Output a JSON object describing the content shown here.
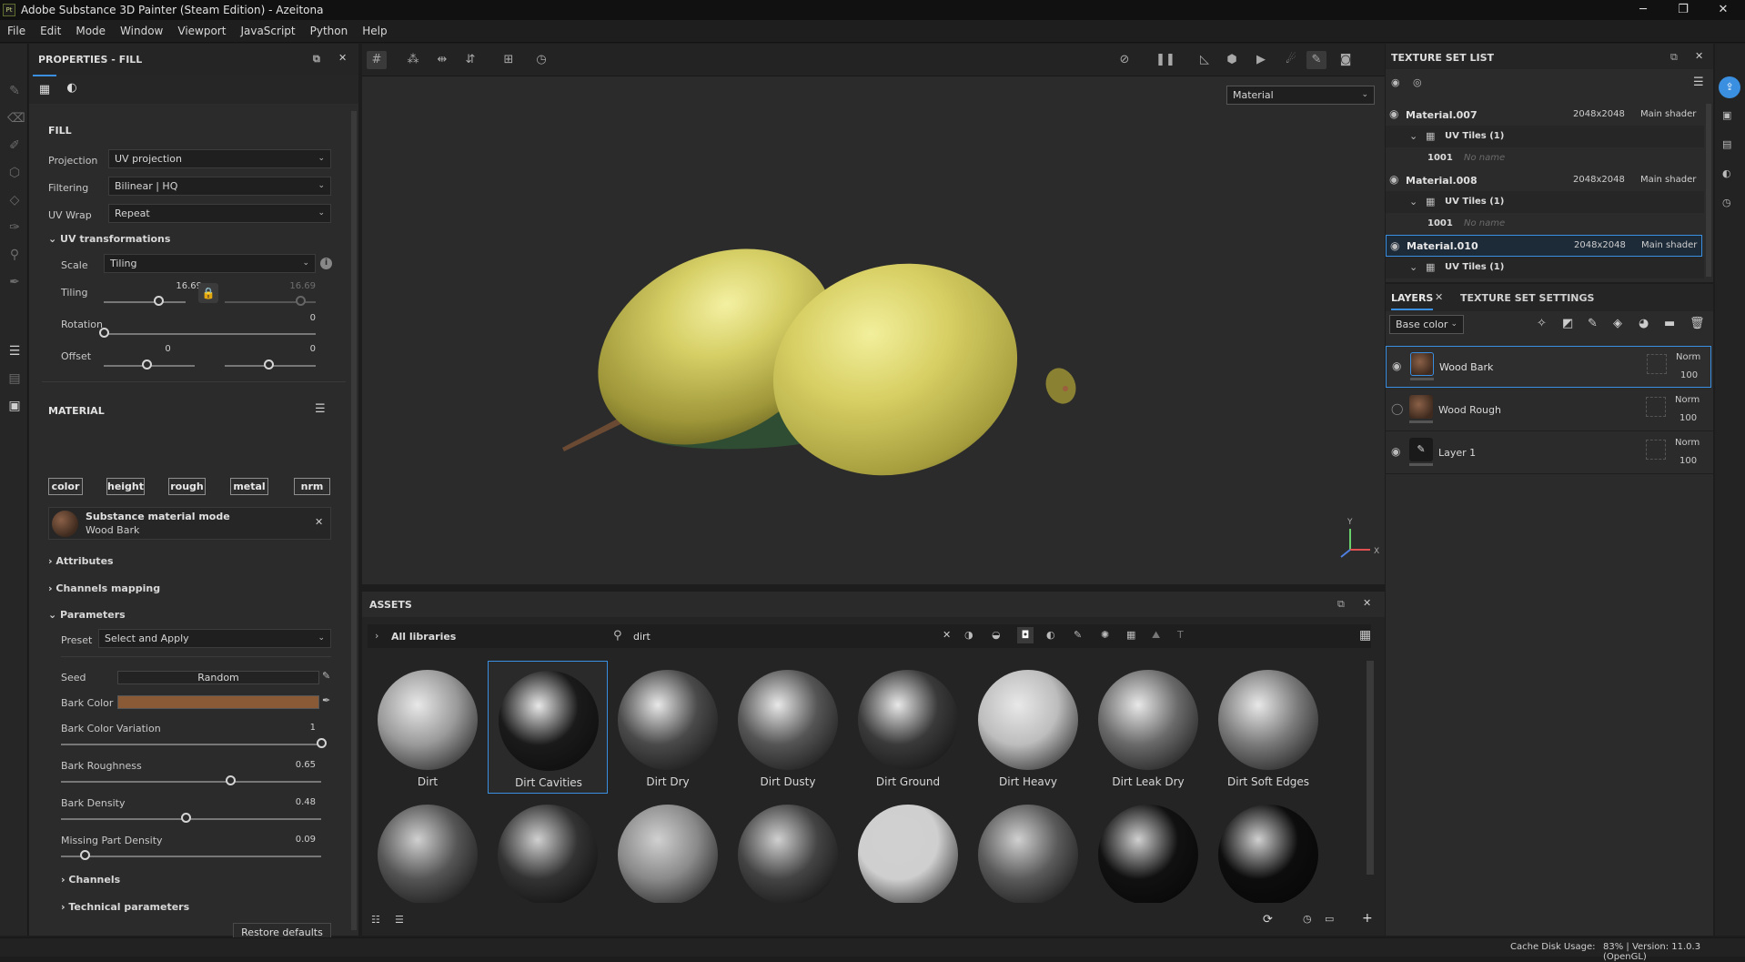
{
  "window": {
    "title": "Adobe Substance 3D Painter (Steam Edition) - Azeitona",
    "app_icon": "Pt"
  },
  "menu": [
    "File",
    "Edit",
    "Mode",
    "Window",
    "Viewport",
    "JavaScript",
    "Python",
    "Help"
  ],
  "properties": {
    "title": "PROPERTIES - FILL",
    "fill_header": "FILL",
    "projection": {
      "label": "Projection",
      "value": "UV projection"
    },
    "filtering": {
      "label": "Filtering",
      "value": "Bilinear | HQ"
    },
    "uv_wrap": {
      "label": "UV Wrap",
      "value": "Repeat"
    },
    "uv_transformations": {
      "header": "UV transformations",
      "scale": {
        "label": "Scale",
        "value": "Tiling"
      },
      "tiling": {
        "label": "Tiling",
        "value_u": "16.69",
        "value_v": "16.69",
        "u_fraction": 0.67
      },
      "rotation": {
        "label": "Rotation",
        "value": "0",
        "fraction": 0.0
      },
      "offset": {
        "label": "Offset",
        "value_u": "0",
        "value_v": "0",
        "u_fraction": 0.5,
        "v_fraction": 0.5
      }
    },
    "material": {
      "header": "MATERIAL",
      "channels": [
        "color",
        "height",
        "rough",
        "metal",
        "nrm"
      ],
      "mode_title": "Substance material mode",
      "mode_name": "Wood Bark"
    },
    "attributes": "Attributes",
    "channels_mapping": "Channels mapping",
    "parameters": {
      "header": "Parameters",
      "preset": {
        "label": "Preset",
        "value": "Select and Apply"
      },
      "seed": {
        "label": "Seed",
        "value": "Random"
      },
      "bark_color": {
        "label": "Bark Color",
        "color": "#8a5a36"
      },
      "bark_color_variation": {
        "label": "Bark Color Variation",
        "value": "1",
        "fraction": 1.0
      },
      "bark_roughness": {
        "label": "Bark Roughness",
        "value": "0.65",
        "fraction": 0.65
      },
      "bark_density": {
        "label": "Bark Density",
        "value": "0.48",
        "fraction": 0.48
      },
      "missing_part_density": {
        "label": "Missing Part Density",
        "value": "0.09",
        "fraction": 0.09
      }
    },
    "channels": "Channels",
    "technical_parameters": "Technical parameters",
    "restore_defaults": "Restore defaults"
  },
  "viewport": {
    "mode": "Material",
    "gizmo_y": "Y",
    "gizmo_x": "X"
  },
  "assets": {
    "title": "ASSETS",
    "library": "All libraries",
    "search": "dirt",
    "items": [
      {
        "name": "Dirt",
        "shade": "#9a9a9a",
        "selected": false
      },
      {
        "name": "Dirt Cavities",
        "shade": "#1a1a1a",
        "selected": true
      },
      {
        "name": "Dirt Dry",
        "shade": "#4a4a4a",
        "selected": false
      },
      {
        "name": "Dirt Dusty",
        "shade": "#555555",
        "selected": false
      },
      {
        "name": "Dirt Ground",
        "shade": "#3a3a3a",
        "selected": false
      },
      {
        "name": "Dirt Heavy",
        "shade": "#bdbdbd",
        "selected": false
      },
      {
        "name": "Dirt Leak Dry",
        "shade": "#6a6a6a",
        "selected": false
      },
      {
        "name": "Dirt Soft Edges",
        "shade": "#7a7a7a",
        "selected": false
      }
    ],
    "row2_shades": [
      "#555555",
      "#333333",
      "#8a8a8a",
      "#444444",
      "#cfcfcf",
      "#5a5a5a",
      "#111111",
      "#0d0d0d"
    ]
  },
  "texture_set_list": {
    "title": "TEXTURE SET LIST",
    "sets": [
      {
        "name": "Material.007",
        "resolution": "2048x2048",
        "shader": "Main shader",
        "uv": "UV Tiles (1)",
        "tile": "1001",
        "tile_name": "No name"
      },
      {
        "name": "Material.008",
        "resolution": "2048x2048",
        "shader": "Main shader",
        "uv": "UV Tiles (1)",
        "tile": "1001",
        "tile_name": "No name"
      },
      {
        "name": "Material.010",
        "resolution": "2048x2048",
        "shader": "Main shader",
        "uv": "UV Tiles (1)"
      }
    ]
  },
  "layers": {
    "tab_layers": "LAYERS",
    "tab_settings": "TEXTURE SET SETTINGS",
    "channel": "Base color",
    "items": [
      {
        "name": "Wood Bark",
        "blend": "Norm",
        "opacity": "100",
        "visible": true,
        "selected": true
      },
      {
        "name": "Wood Rough",
        "blend": "Norm",
        "opacity": "100",
        "visible": false,
        "selected": false
      },
      {
        "name": "Layer 1",
        "blend": "Norm",
        "opacity": "100",
        "visible": true,
        "selected": false
      }
    ]
  },
  "status": {
    "cache_label": "Cache Disk Usage:",
    "cache_value": "83% | Version: 11.0.3 (OpenGL)"
  },
  "colors": {
    "accent": "#3b8fe0",
    "olive": "#c9c45e",
    "leaf": "#2f4d32"
  }
}
